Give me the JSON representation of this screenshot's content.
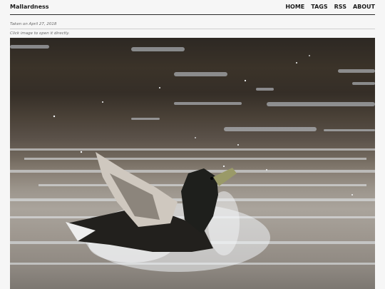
{
  "site": {
    "title": "Mallardness"
  },
  "nav": {
    "items": [
      "HOME",
      "TAGS",
      "RSS",
      "ABOUT"
    ]
  },
  "post": {
    "taken": "Taken on April 27, 2018",
    "hint": "Click image to open it directly."
  },
  "icons": {
    "photo": "bathing-mallard-duck-photo"
  }
}
